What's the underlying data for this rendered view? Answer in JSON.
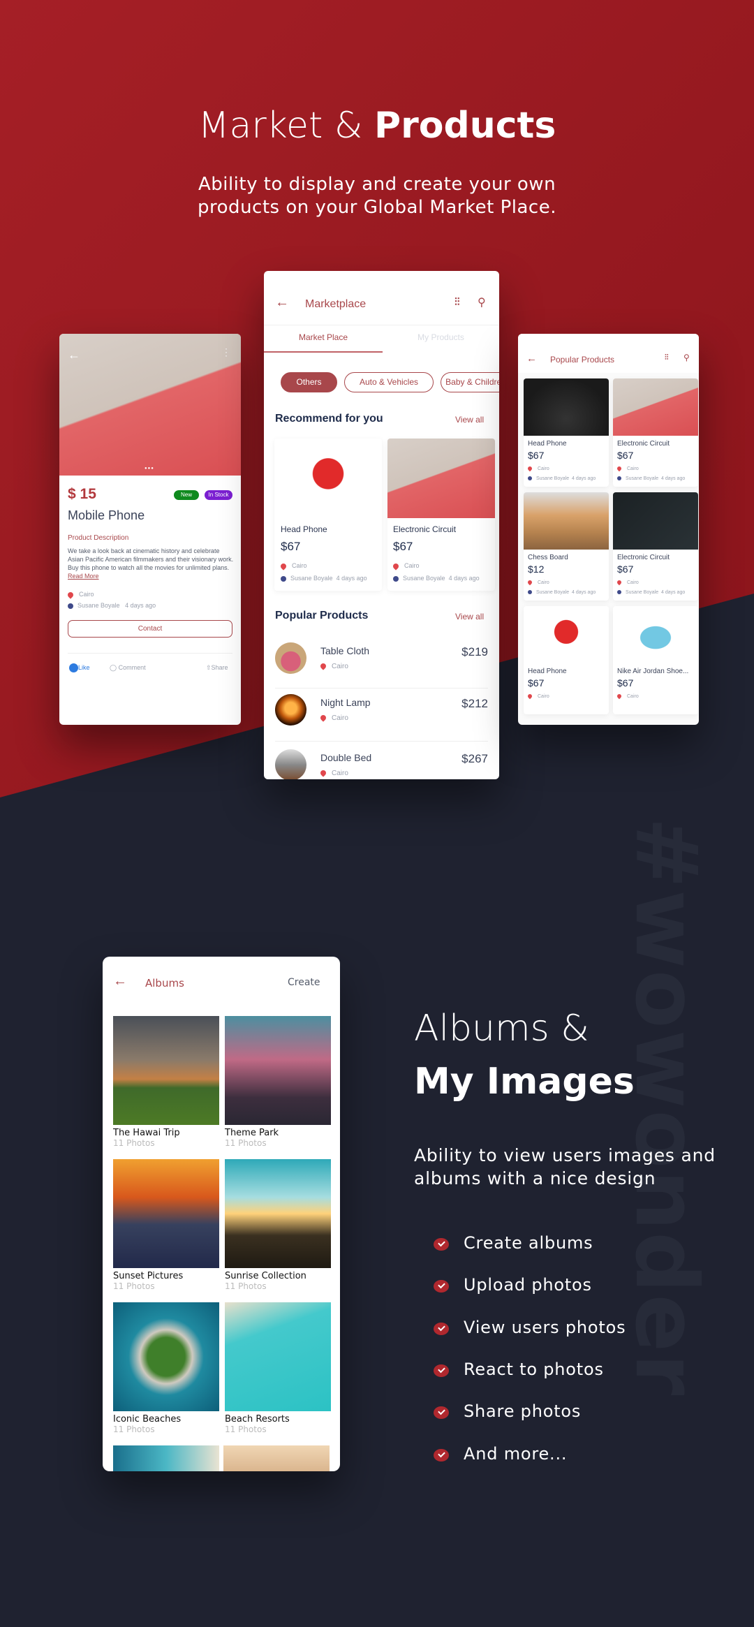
{
  "hero": {
    "title_light": "Market & ",
    "title_bold": "Products",
    "subtitle_line1": "Ability to display and create your own",
    "subtitle_line2": "products on your Global Market Place."
  },
  "colors": {
    "brand_red": "#a8474b",
    "bg_red": "#9e1c22",
    "bg_dark": "#1f2230",
    "new_badge": "#0f8a1e",
    "stock_badge": "#7b1fd1"
  },
  "product_detail": {
    "price": "$ 15",
    "badge_new": "New",
    "badge_stock": "In Stock",
    "name": "Mobile Phone",
    "desc_label": "Product Description",
    "desc": "We take a look back at cinematic history and celebrate Asian Pacific American filmmakers and their visionary work. Buy this phone to watch all the movies for unlimited plans.",
    "read_more": "Read More",
    "location": "Cairo",
    "seller": "Susane Boyale",
    "time": "4 days ago",
    "contact": "Contact",
    "like": "Like",
    "comment": "Comment",
    "share": "Share"
  },
  "marketplace": {
    "title": "Marketplace",
    "tabs": [
      "Market Place",
      "My Products"
    ],
    "chips": [
      "Others",
      "Auto & Vehicles",
      "Baby & Children"
    ],
    "recommend_title": "Recommend for you",
    "view_all": "View all",
    "recommended": [
      {
        "name": "Head Phone",
        "price": "$67",
        "location": "Cairo",
        "seller": "Susane Boyale",
        "time": "4 days ago"
      },
      {
        "name": "Electronic Circuit",
        "price": "$67",
        "location": "Cairo",
        "seller": "Susane Boyale",
        "time": "4 days ago"
      }
    ],
    "popular_title": "Popular Products",
    "popular": [
      {
        "name": "Table Cloth",
        "location": "Cairo",
        "price": "$219"
      },
      {
        "name": "Night Lamp",
        "location": "Cairo",
        "price": "$212"
      },
      {
        "name": "Double Bed",
        "location": "Cairo",
        "price": "$267"
      }
    ]
  },
  "popular_products": {
    "title": "Popular Products",
    "items": [
      {
        "name": "Head Phone",
        "price": "$67",
        "location": "Cairo",
        "seller": "Susane Boyale",
        "time": "4 days ago"
      },
      {
        "name": "Electronic Circuit",
        "price": "$67",
        "location": "Cairo",
        "seller": "Susane Boyale",
        "time": "4 days ago"
      },
      {
        "name": "Chess Board",
        "price": "$12",
        "location": "Cairo",
        "seller": "Susane Boyale",
        "time": "4 days ago"
      },
      {
        "name": "Electronic Circuit",
        "price": "$67",
        "location": "Cairo",
        "seller": "Susane Boyale",
        "time": "4 days ago"
      },
      {
        "name": "Head Phone",
        "price": "$67",
        "location": "Cairo"
      },
      {
        "name": "Nike Air Jordan Shoe...",
        "price": "$67",
        "location": "Cairo"
      }
    ]
  },
  "albums": {
    "title": "Albums",
    "create": "Create",
    "items": [
      {
        "name": "The Hawai Trip",
        "count": "11 Photos"
      },
      {
        "name": "Theme Park",
        "count": "11 Photos"
      },
      {
        "name": "Sunset Pictures",
        "count": "11 Photos"
      },
      {
        "name": "Sunrise Collection",
        "count": "11 Photos"
      },
      {
        "name": "Iconic Beaches",
        "count": "11 Photos"
      },
      {
        "name": "Beach Resorts",
        "count": "11 Photos"
      }
    ]
  },
  "albums_section": {
    "title_line1": "Albums &",
    "title_line2": "My Images",
    "desc_line1": "Ability to view users images and",
    "desc_line2": "albums with a nice design",
    "features": [
      "Create albums",
      "Upload photos",
      "View users photos",
      "React to photos",
      "Share photos",
      "And more..."
    ]
  },
  "watermark": "#wowonder"
}
